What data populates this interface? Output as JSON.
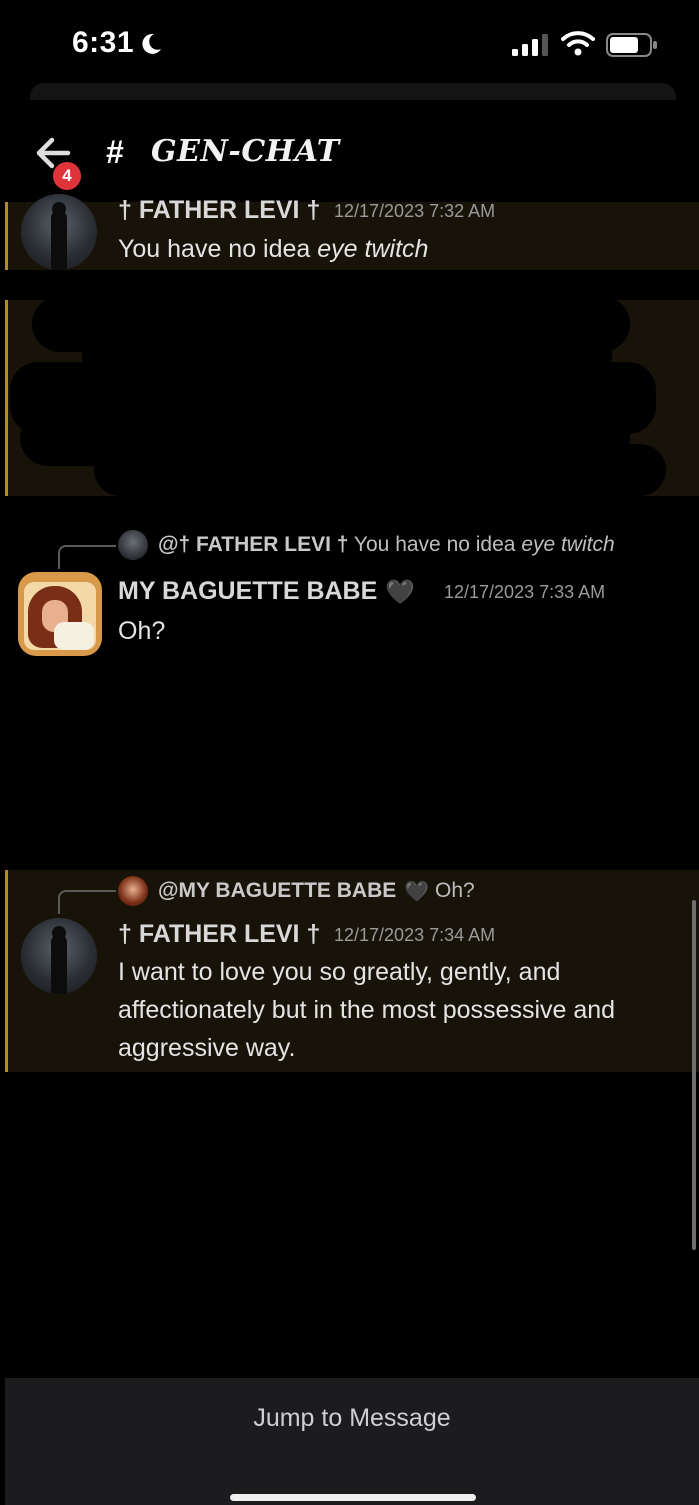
{
  "status_bar": {
    "time": "6:31",
    "icons": [
      "moon-icon",
      "signal-icon",
      "wifi-icon",
      "battery-icon"
    ]
  },
  "header": {
    "back_badge": "4",
    "hash": "#",
    "channel_name": "GEN-CHAT"
  },
  "messages": [
    {
      "author": "† FATHER LEVI †",
      "timestamp": "12/17/2023 7:32 AM",
      "text_plain": "You have no idea ",
      "text_italic": "eye twitch"
    },
    {
      "reply": {
        "author": "@† FATHER LEVI †",
        "text_plain": " You have no idea ",
        "text_italic": "eye twitch"
      },
      "author": "MY BAGUETTE BABE",
      "heart": "🖤",
      "timestamp": "12/17/2023 7:33 AM",
      "text": "Oh?"
    },
    {
      "reply": {
        "author": "@MY BAGUETTE BABE",
        "heart": "🖤",
        "text": "Oh?"
      },
      "author": "† FATHER LEVI †",
      "timestamp": "12/17/2023 7:34 AM",
      "text": "I want to love you so greatly, gently, and affectionately but in the most possessive and aggressive way."
    }
  ],
  "footer": {
    "jump_label": "Jump to Message"
  },
  "colors": {
    "background": "#000000",
    "highlight_bg": "#171308",
    "highlight_border": "#b58a2c",
    "badge": "#e0343b",
    "jump_bar": "#1c1c1f"
  }
}
